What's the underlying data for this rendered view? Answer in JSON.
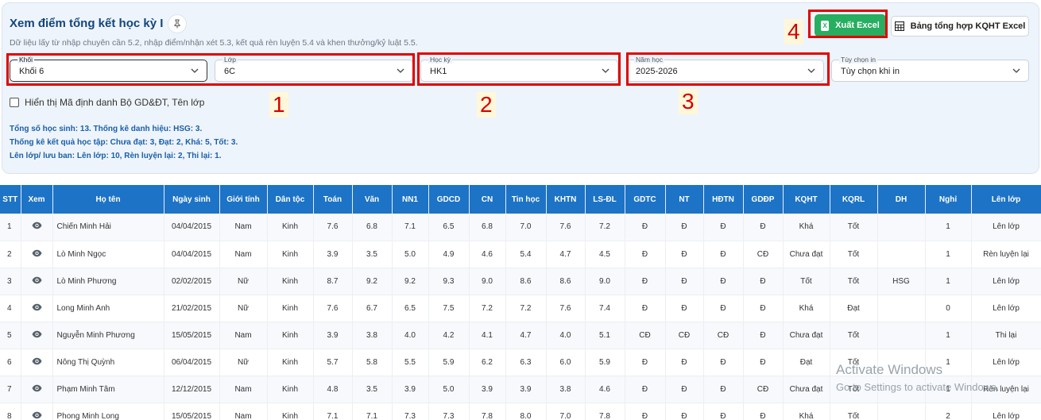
{
  "header": {
    "title": "Xem điểm tổng kết học kỳ I",
    "subtitle": "Dữ liệu lấy từ nhập chuyên cần 5.2, nhập điểm/nhận xét 5.3, kết quả rèn luyện 5.4 và khen thưởng/kỷ luật 5.5.",
    "export_label": "Xuất Excel",
    "summary_label": "Bảng tổng hợp KQHT Excel"
  },
  "filters": {
    "khoi": {
      "label": "Khối",
      "value": "Khối 6"
    },
    "lop": {
      "label": "Lớp",
      "value": "6C"
    },
    "hocky": {
      "label": "Học kỳ",
      "value": "HK1"
    },
    "namhoc": {
      "label": "Năm học",
      "value": "2025-2026"
    },
    "tuychon": {
      "label": "Tùy chọn in",
      "value": "Tùy chọn khi in"
    }
  },
  "checkbox_label": "Hiển thị Mã định danh Bộ GD&ĐT, Tên lớp",
  "stats": [
    "Tổng số học sinh: 13. Thống kê danh hiệu: HSG: 3.",
    "Thống kê kết quả học tập: Chưa đạt: 3, Đạt: 2, Khá: 5, Tốt: 3.",
    "Lên lớp/ lưu ban: Lên lớp: 10, Rèn luyện lại: 2, Thi lại: 1."
  ],
  "annotations": [
    "1",
    "2",
    "3",
    "4"
  ],
  "table": {
    "columns": [
      "STT",
      "Xem",
      "Họ tên",
      "Ngày sinh",
      "Giới tính",
      "Dân tộc",
      "Toán",
      "Văn",
      "NN1",
      "GDCD",
      "CN",
      "Tin học",
      "KHTN",
      "LS-ĐL",
      "GDTC",
      "NT",
      "HĐTN",
      "GDĐP",
      "KQHT",
      "KQRL",
      "DH",
      "Nghỉ",
      "Lên lớp"
    ],
    "rows": [
      [
        "1",
        "Chiến Minh Hải",
        "04/04/2015",
        "Nam",
        "Kinh",
        "7.6",
        "6.8",
        "7.1",
        "6.5",
        "6.8",
        "7.0",
        "7.6",
        "7.2",
        "Đ",
        "Đ",
        "Đ",
        "Đ",
        "Khá",
        "Tốt",
        "",
        "1",
        "Lên lớp"
      ],
      [
        "2",
        "Lò Minh Ngọc",
        "04/04/2015",
        "Nam",
        "Kinh",
        "3.9",
        "3.5",
        "5.0",
        "4.9",
        "4.6",
        "5.4",
        "4.7",
        "4.5",
        "Đ",
        "Đ",
        "Đ",
        "CĐ",
        "Chưa đạt",
        "Tốt",
        "",
        "1",
        "Rèn luyện lại"
      ],
      [
        "3",
        "Lò Minh Phương",
        "02/02/2015",
        "Nữ",
        "Kinh",
        "8.7",
        "9.2",
        "9.2",
        "9.3",
        "9.0",
        "8.6",
        "8.6",
        "9.0",
        "Đ",
        "Đ",
        "Đ",
        "Đ",
        "Tốt",
        "Tốt",
        "HSG",
        "1",
        "Lên lớp"
      ],
      [
        "4",
        "Long Minh Anh",
        "21/02/2015",
        "Nữ",
        "Kinh",
        "7.6",
        "6.7",
        "6.5",
        "7.5",
        "7.2",
        "7.2",
        "7.6",
        "7.4",
        "Đ",
        "Đ",
        "Đ",
        "Đ",
        "Khá",
        "Đạt",
        "",
        "0",
        "Lên lớp"
      ],
      [
        "5",
        "Nguyễn Minh Phương",
        "15/05/2015",
        "Nam",
        "Kinh",
        "3.9",
        "3.8",
        "4.0",
        "4.2",
        "4.1",
        "4.7",
        "4.0",
        "5.1",
        "CĐ",
        "CĐ",
        "CĐ",
        "Đ",
        "Chưa đạt",
        "Tốt",
        "",
        "1",
        "Thi lại"
      ],
      [
        "6",
        "Nông Thị Quỳnh",
        "06/04/2015",
        "Nữ",
        "Kinh",
        "5.7",
        "5.8",
        "5.5",
        "5.9",
        "6.2",
        "6.3",
        "6.0",
        "5.9",
        "Đ",
        "Đ",
        "Đ",
        "Đ",
        "Đạt",
        "Tốt",
        "",
        "1",
        "Lên lớp"
      ],
      [
        "7",
        "Phạm Minh Tâm",
        "12/12/2015",
        "Nam",
        "Kinh",
        "4.8",
        "3.5",
        "3.9",
        "5.0",
        "3.9",
        "3.9",
        "3.8",
        "4.6",
        "Đ",
        "Đ",
        "Đ",
        "CĐ",
        "Chưa đạt",
        "Tốt",
        "",
        "1",
        "Rèn luyện lại"
      ],
      [
        "8",
        "Phong Minh Long",
        "15/05/2015",
        "Nam",
        "Kinh",
        "7.1",
        "7.1",
        "7.3",
        "7.3",
        "7.8",
        "8.0",
        "7.0",
        "7.8",
        "Đ",
        "Đ",
        "Đ",
        "Đ",
        "Khá",
        "Tốt",
        "",
        "2",
        "Lên lớp"
      ]
    ]
  },
  "watermark": {
    "line1": "Activate Windows",
    "line2": "Go to Settings to activate Windows."
  }
}
